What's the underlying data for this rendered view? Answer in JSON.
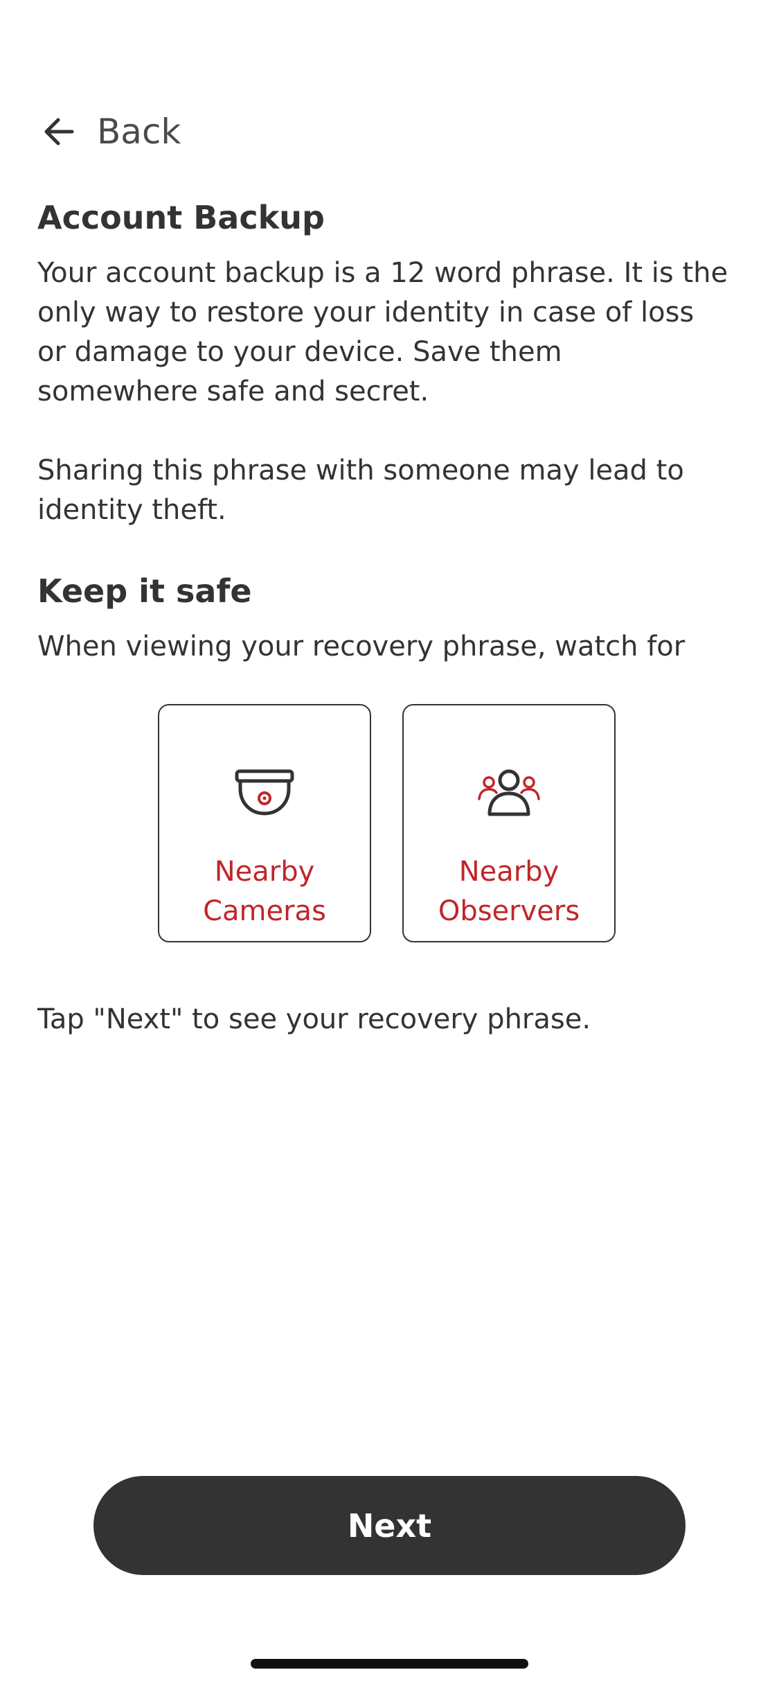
{
  "nav": {
    "back_label": "Back"
  },
  "header": {
    "title": "Account Backup"
  },
  "body": {
    "intro": "Your account backup is a 12 word phrase. It is the only way to restore your identity in case of loss or damage to your device. Save them somewhere safe and secret.",
    "warning": "Sharing this phrase with someone may lead to identity theft."
  },
  "safety": {
    "title": "Keep it safe",
    "subtitle": "When viewing your recovery phrase, watch for",
    "cards": [
      {
        "label": "Nearby Cameras",
        "icon": "security-camera-icon"
      },
      {
        "label": "Nearby Observers",
        "icon": "people-group-icon"
      }
    ]
  },
  "instructions": "Tap \"Next\" to see your recovery phrase.",
  "actions": {
    "next_label": "Next"
  },
  "colors": {
    "accent": "#c0262a",
    "primary_button": "#333333",
    "text": "#333333"
  }
}
